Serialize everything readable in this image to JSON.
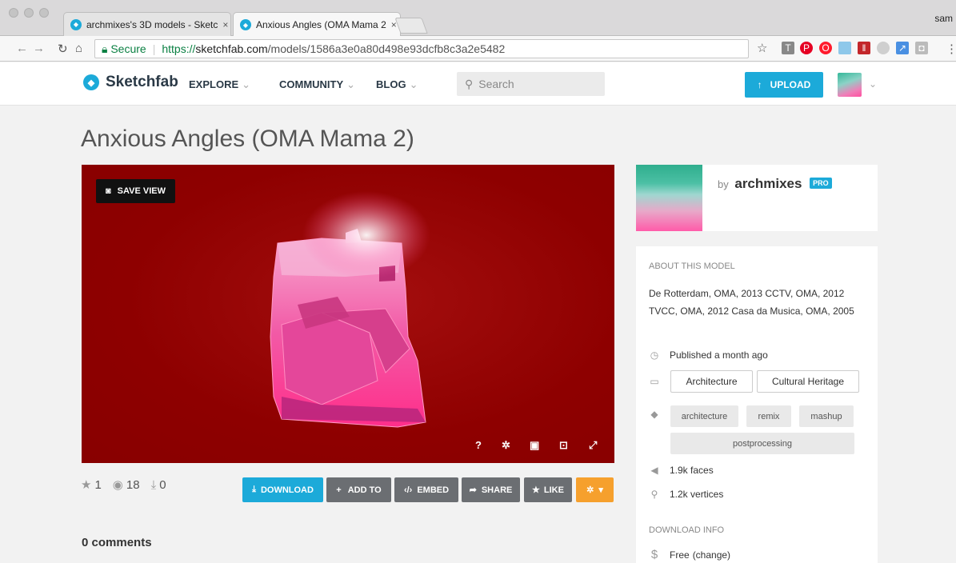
{
  "browser": {
    "tabs": [
      {
        "title": "archmixes's 3D models - Sketc",
        "close": "×"
      },
      {
        "title": "Anxious Angles (OMA Mama 2",
        "close": "×"
      }
    ],
    "user": "sam",
    "secure_label": "Secure",
    "url_scheme": "https://",
    "url_host": "sketchfab.com",
    "url_path": "/models/1586a3e0a80d498e93dcfb8c3a2e5482"
  },
  "site": {
    "logo": "Sketchfab",
    "nav": [
      {
        "label": "EXPLORE"
      },
      {
        "label": "COMMUNITY"
      },
      {
        "label": "BLOG"
      }
    ],
    "search_placeholder": "Search",
    "upload_label": "UPLOAD"
  },
  "model": {
    "title": "Anxious Angles (OMA Mama 2)",
    "save_view": "SAVE VIEW",
    "stats": {
      "stars": "1",
      "views": "18",
      "downloads": "0"
    },
    "actions": {
      "download": "DOWNLOAD",
      "add_to": "ADD TO",
      "embed": "EMBED",
      "share": "SHARE",
      "like": "LIKE"
    },
    "comments": "0 comments"
  },
  "sidebar": {
    "by": "by",
    "author": "archmixes",
    "pro": "PRO",
    "about_heading": "ABOUT THIS MODEL",
    "description": "De Rotterdam, OMA, 2013 CCTV, OMA, 2012 TVCC, OMA, 2012 Casa da Musica, OMA, 2005",
    "published": "Published a month ago",
    "categories": [
      "Architecture",
      "Cultural Heritage"
    ],
    "tags": [
      "architecture",
      "remix",
      "mashup",
      "postprocessing"
    ],
    "faces": "1.9k faces",
    "vertices": "1.2k vertices",
    "download_heading": "DOWNLOAD INFO",
    "price": "Free",
    "change": "(change)"
  },
  "colors": {
    "accent": "#1caad9",
    "viewer_bg": "#8e0000",
    "model_pink": "#ff3d9a",
    "action_gray": "#6b6e72",
    "action_orange": "#f6a02d"
  }
}
